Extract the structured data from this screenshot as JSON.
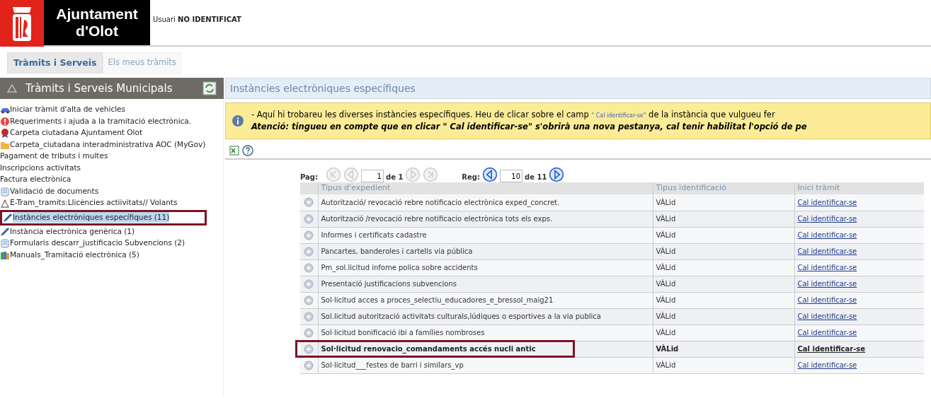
{
  "header": {
    "logo_line_1": "Ajuntament",
    "logo_line_2": "d'Olot",
    "user_label": "Usuari",
    "user_name": "NO IDENTIFICAT"
  },
  "tabs": [
    {
      "label": "Tràmits i Serveis",
      "selected": true
    },
    {
      "label": "Els meus tràmits",
      "selected": false
    }
  ],
  "sidebar": {
    "title": "Tràmits i Serveis Municipals",
    "items": [
      {
        "label": "Iniciar tràmit d'alta de vehicles",
        "kind": "car",
        "selected": false
      },
      {
        "label": "Requeriments i ajuda a la tramitació electrònica.",
        "kind": "alert",
        "selected": false
      },
      {
        "label": "Carpeta ciutadana Ajuntament Olot",
        "kind": "seal",
        "selected": false
      },
      {
        "label": "Carpeta_ciutadana interadministrativa AOC (MyGov)",
        "kind": "folder",
        "selected": false
      },
      {
        "label": "Pagament de tributs i multes",
        "kind": "plain",
        "selected": false
      },
      {
        "label": "Inscripcions activitats",
        "kind": "plain",
        "selected": false
      },
      {
        "label": "Factura electrònica",
        "kind": "plain",
        "selected": false
      },
      {
        "label": "Validació de documents",
        "kind": "document",
        "selected": false
      },
      {
        "label": "E-Tram_tramits:Llicències actiivitats// Volants",
        "kind": "tool",
        "selected": false
      },
      {
        "label": "Instàncies electròniques específiques (11)",
        "kind": "pen",
        "selected": true
      },
      {
        "label": "Instància electrònica genèrica (1)",
        "kind": "pen",
        "selected": false
      },
      {
        "label": "Formularis descarr_justificacio Subvencions (2)",
        "kind": "document",
        "selected": false
      },
      {
        "label": "Manuals_Tramitació electrònica (5)",
        "kind": "books",
        "selected": false
      }
    ]
  },
  "panel": {
    "title": "Instàncies electròniques específiques",
    "notice": {
      "line_1_before": "- Aquí hi trobareu les diverses instàncies específiques. Heu de clicar sobre el camp",
      "line_1_link": "\" Cal identificar-se\"",
      "line_1_after": "de la instància que vulgueu fer",
      "line_2": "Atenció: tingueu en compte que en clicar \" Cal identificar-se\" s'obrirà una nova pestanya, cal tenir habilitat l'opció de pe"
    },
    "pagination": {
      "page_label": "Pag:",
      "page_value": "1",
      "page_total": "de 1",
      "page_buttons": [
        {
          "kind": "first",
          "disabled": true
        },
        {
          "kind": "prev",
          "disabled": true
        },
        {
          "kind": "next",
          "disabled": true
        },
        {
          "kind": "last",
          "disabled": true
        }
      ],
      "records_label": "Reg:",
      "records_value": "10",
      "records_total": "de 11",
      "record_buttons": [
        {
          "kind": "prev",
          "disabled": false
        },
        {
          "kind": "next",
          "disabled": false
        }
      ]
    },
    "table": {
      "columns": [
        "Tipus d'expedient",
        "Tipus identificació",
        "Inici tràmit"
      ],
      "rows": [
        {
          "type": "Autorització/ revocació rebre notificacio electrònica exped_concret.",
          "identification": "VÀLid",
          "action": "Cal identificar-se",
          "selected": false
        },
        {
          "type": "Autorització /revocació rebre notificacio electrònica tots els exps.",
          "identification": "VÀLid",
          "action": "Cal identificar-se",
          "selected": false
        },
        {
          "type": "Informes i certificats cadastre",
          "identification": "VÀLid",
          "action": "Cal identificar-se",
          "selected": false
        },
        {
          "type": "Pancartes, banderoles i cartells via pública",
          "identification": "VÀLid",
          "action": "Cal identificar-se",
          "selected": false
        },
        {
          "type": "Pm_sol.licitud infome polica sobre accidents",
          "identification": "VÀLid",
          "action": "Cal identificar-se",
          "selected": false
        },
        {
          "type": "Presentació justificacions subvencions",
          "identification": "VÀLid",
          "action": "Cal identificar-se",
          "selected": false
        },
        {
          "type": "Sol·licitud acces a proces_selectiu_educadores_e_bressol_maig21",
          "identification": "VÀLid",
          "action": "Cal identificar-se",
          "selected": false
        },
        {
          "type": "Sol.licitud autorització activitats culturals,lúdiques o esportives a la via publica",
          "identification": "VÀLid",
          "action": "Cal identificar-se",
          "selected": false
        },
        {
          "type": "Sol·licitud bonificació ibi a famílies nombroses",
          "identification": "VÀLid",
          "action": "Cal identificar-se",
          "selected": false
        },
        {
          "type": "Sol·licitud renovacio_comandaments accés nucli antic",
          "identification": "VÀLid",
          "action": "Cal identificar-se",
          "selected": true
        },
        {
          "type": "Sol·licitud___festes de barri i similars_vp",
          "identification": "VÀLid",
          "action": "Cal identificar-se",
          "selected": false
        }
      ]
    }
  }
}
